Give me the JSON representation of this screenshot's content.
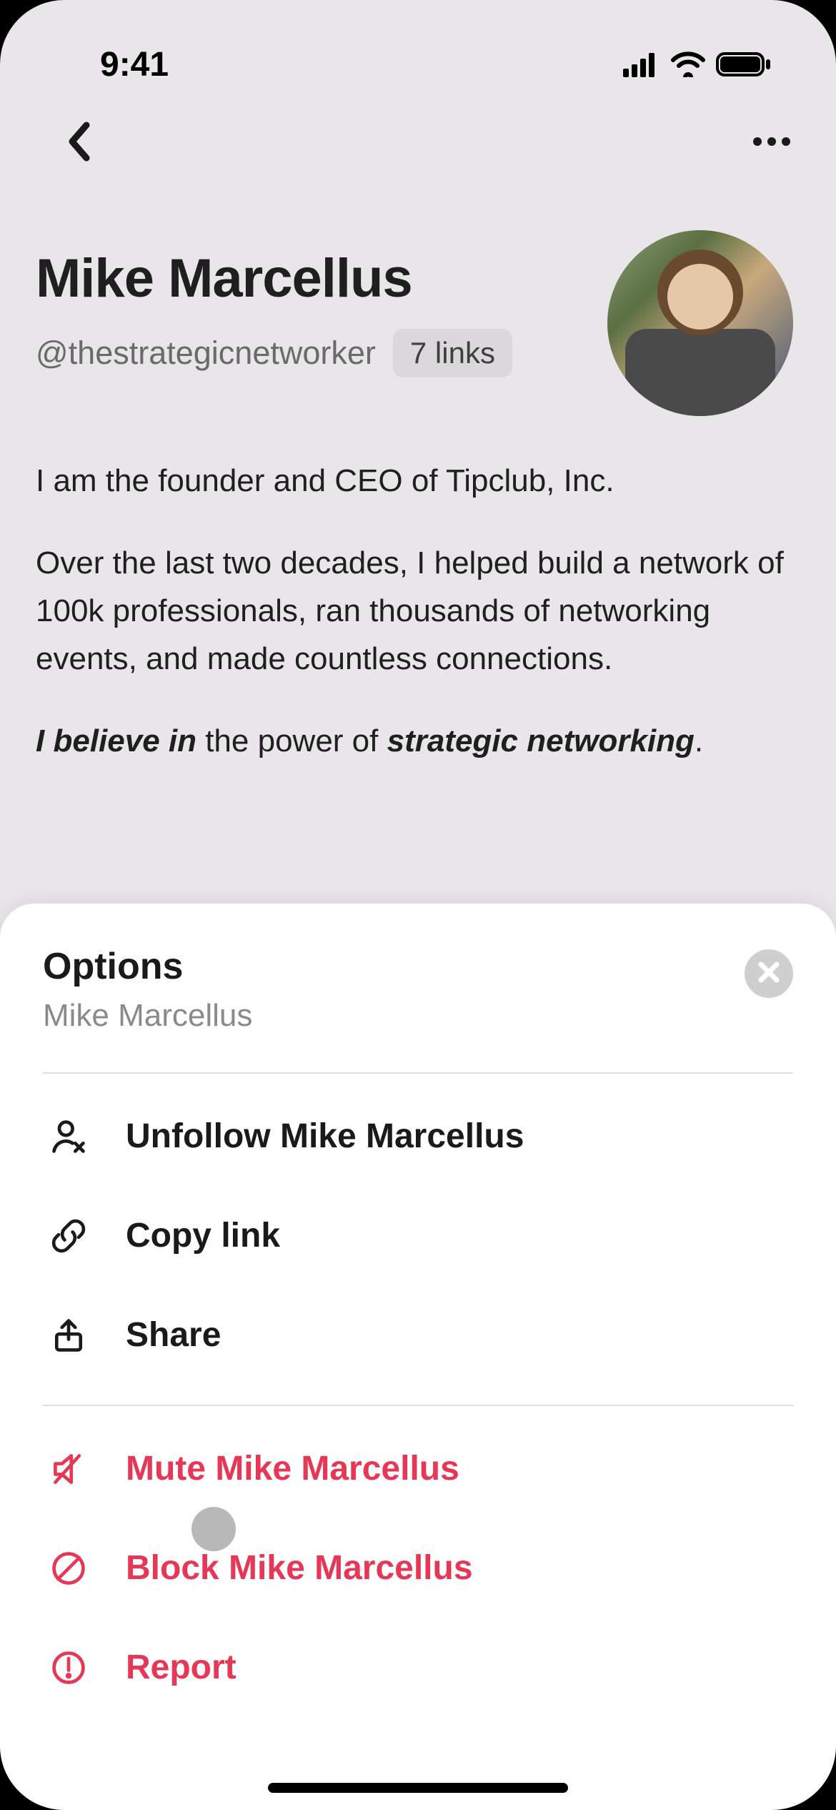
{
  "status": {
    "time": "9:41"
  },
  "profile": {
    "name": "Mike Marcellus",
    "handle": "@thestrategicnetworker",
    "links_label": "7 links",
    "bio_p1": "I am the founder and CEO of Tipclub, Inc.",
    "bio_p2": "Over the last two decades, I helped build a network of 100k professionals, ran thousands of networking events, and made countless connections.",
    "bio_believe": "I believe in",
    "bio_mid": " the power of ",
    "bio_strategic": "strategic networking",
    "bio_end": "."
  },
  "sheet": {
    "title": "Options",
    "subtitle": "Mike Marcellus",
    "items": {
      "unfollow": "Unfollow Mike Marcellus",
      "copy_link": "Copy link",
      "share": "Share",
      "mute": "Mute Mike Marcellus",
      "block": "Block Mike Marcellus",
      "report": "Report"
    }
  },
  "colors": {
    "danger": "#e63757"
  }
}
